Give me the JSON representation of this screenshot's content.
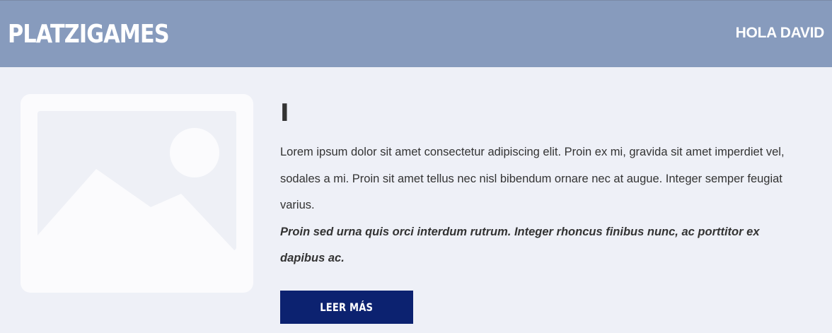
{
  "header": {
    "logo": "PLATZIGAMES",
    "greeting": "HOLA DAVID",
    "background": "#879bbd"
  },
  "article": {
    "image_icon": "image-placeholder-icon",
    "title": "I",
    "paragraph": "Lorem ipsum dolor sit amet consectetur adipiscing elit. Proin ex mi, gravida sit amet imperdiet vel, sodales a mi. Proin sit amet tellus nec nisl bibendum ornare nec at augue. Integer semper feugiat varius.",
    "emphasis": "Proin sed urna quis orci interdum rutrum. Integer rhoncus finibus nunc, ac porttitor ex dapibus ac.",
    "button_label": "LEER MÁS",
    "button_color": "#0c2270"
  }
}
